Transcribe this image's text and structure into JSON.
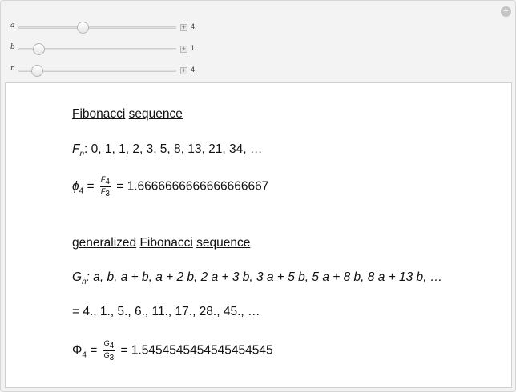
{
  "controls": {
    "sliders": [
      {
        "label": "a",
        "value": "4.",
        "fraction": 0.41
      },
      {
        "label": "b",
        "value": "1.",
        "fraction": 0.13
      },
      {
        "label": "n",
        "value": "4",
        "fraction": 0.12
      }
    ],
    "plus_symbol": "+",
    "corner_symbol": "+"
  },
  "output": {
    "fib_heading": {
      "word1": "Fibonacci",
      "word2": "sequence"
    },
    "fn": {
      "symbol": "F",
      "subscript": "n",
      "terms": ": 0, 1, 1, 2, 3, 5, 8, 13, 21, 34, …"
    },
    "phi": {
      "symbol": "ϕ",
      "index": "4",
      "num": "F",
      "num_sub": "4",
      "den": "F",
      "den_sub": "3",
      "value": "= 1.6666666666666666667"
    },
    "gen_heading": {
      "word1": "generalized",
      "word2": "Fibonacci",
      "word3": "sequence"
    },
    "gn": {
      "symbol": "G",
      "subscript": "n",
      "terms": ": a, b, a + b, a + 2 b, 2 a + 3 b, 3 a + 5 b, 5 a + 8 b, 8 a + 13 b, …"
    },
    "gn_values": "= 4., 1., 5., 6., 11., 17., 28., 45., …",
    "Phi": {
      "symbol": "Φ",
      "index": "4",
      "num": "G",
      "num_sub": "4",
      "den": "G",
      "den_sub": "3",
      "value": "= 1.5454545454545454545"
    }
  }
}
